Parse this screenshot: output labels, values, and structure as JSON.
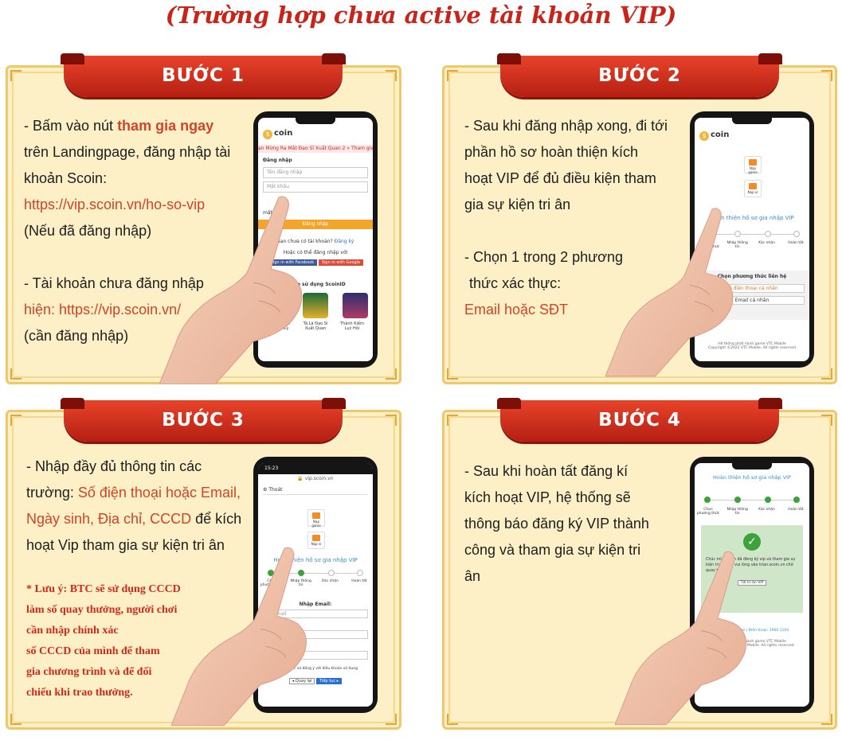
{
  "title": "(Trường hợp chưa active tài khoản VIP)",
  "steps": [
    {
      "label": "BƯỚC 1",
      "lines": {
        "l1a": "- Bấm vào nút ",
        "l1b": "tham gia ngay",
        "l2": "trên Landingpage, đăng nhập tài",
        "l3": "khoản Scoin:",
        "l4": "https://vip.scoin.vn/ho-so-vip",
        "l5": "(Nếu đã đăng nhập)",
        "l6": "- Tài khoản chưa đăng nhập",
        "l7a": "hiện: ",
        "l7b": "https://vip.scoin.vn/",
        "l8": "(cần đăng nhập)"
      },
      "phone": {
        "logo": "coin",
        "marquee": "ạn Mừng Ra Mắt Đạo Sĩ Xuất Quan 2 » Tham gia n",
        "login_title": "Đăng nhập",
        "username_placeholder": "Tên đăng nhập",
        "password_placeholder": "Mật khẩu",
        "forgot": "mật khẩu?",
        "login_btn": "Đăng nhập",
        "no_account": "Bạn chưa có tài khoản?",
        "register": "Đăng ký",
        "or_login": "Hoặc có thể đăng nhập với",
        "fb_btn": "Sign in with Facebook",
        "gg_btn": "Sign in with Google",
        "products_title": "Các sản phẩm sử dụng ScoinID",
        "games": [
          "Long Chiến Truyền Kỳ",
          "Tà Lã Đạo Sĩ Xuất Quan",
          "Thành Kiếm Lục Hỏi"
        ]
      }
    },
    {
      "label": "BƯỚC 2",
      "lines": {
        "l1": "- Sau khi đăng nhập xong, đi tới",
        "l2": "phần hồ sơ hoàn thiện kích",
        "l3": "hoạt VIP để đủ điều kiện tham",
        "l4": "gia sự kiện tri ân",
        "l5": "- Chọn 1 trong 2 phương",
        "l6": "thức xác thực:",
        "l7": "Email hoặc SĐT"
      },
      "phone": {
        "logo": "coin",
        "icon1": "Nạp game",
        "icon2": "Nạp ví",
        "heading": "Hoàn thiện hồ sơ gia nhập VIP",
        "step_labels": [
          "Chọn phương thức",
          "Nhập thông tin",
          "Xác nhận",
          "Hoàn tất"
        ],
        "method_title": "Chọn phương thức liên hệ",
        "opt1": "Số điện thoại cá nhân",
        "opt2": "Email cá nhân",
        "footer1": "Hệ thống phát hành game VTC Mobile",
        "footer2": "Copyright ©2022 VTC Mobile. All rights reserved"
      }
    },
    {
      "label": "BƯỚC 3",
      "lines": {
        "l1": "- Nhập đầy đủ thông tin các",
        "l2a": "trường: ",
        "l2b": "Số điện thoại hoặc Email,",
        "l3a": "Ngày sinh, Địa chỉ, CCCD",
        "l3b": " để kích",
        "l4": "hoạt Vip tham gia sự kiện tri ân"
      },
      "note": {
        "n1": "* Lưu ý: BTC sẽ sử dụng CCCD",
        "n2": "làm số quay thưởng, người chơi",
        "n3": "cần nhập  chính xác",
        "n4": "số CCCD của mình để tham",
        "n5": "gia chương trình và để đối",
        "n6": "chiếu khi trao thưởng."
      },
      "phone": {
        "time": "15:23",
        "url": "vip.scoin.vn",
        "back": "Thoát",
        "icon1": "Nạp game",
        "icon2": "Nạp ví",
        "heading": "Hoàn thiện hồ sơ gia nhập VIP",
        "step_labels": [
          "Chọn phương thức",
          "Nhập thông tin",
          "Xác nhận",
          "Hoàn tất"
        ],
        "email_label": "Nhập Email:",
        "email_ph": "email",
        "dob_label": "* Ngày sinh:",
        "dob_ph": "dd/mm/yyyy",
        "addr_label": "* Địa chỉ:",
        "addr_ph": "Nhập địa chỉ",
        "agree": "Tôi đã đọc và đồng ý với điều khoản sử dụng",
        "back_btn": "Quay lại",
        "next_btn": "Tiếp tục"
      }
    },
    {
      "label": "BƯỚC 4",
      "lines": {
        "l1": "- Sau khi hoàn tất đăng kí",
        "l2": "kích hoạt VIP, hệ thống sẽ",
        "l3": "thông báo đăng ký VIP thành",
        "l4": "công và tham gia sự kiện tri",
        "l5": "ân"
      },
      "phone": {
        "heading": "Hoàn thiện hồ sơ gia nhập VIP",
        "step_labels": [
          "Chọn phương thức",
          "Nhập thông tin",
          "Xác nhận",
          "Hoàn tất"
        ],
        "success": "Chúc mừng bạn đã đăng ký vip và tham gia sự kiện tri ân vip, vui lòng vào trian.scoin.vn chờ quay thưởng.",
        "ok_btn": "Tới tri ân VIP",
        "links": "Hỗ trợ | Fanpage | Điện thoại: 1900 1104",
        "footer1": "Hệ thống phát hành game VTC Mobile",
        "footer2": "Copyright 2022 VTC Mobile. All rights reserved"
      }
    }
  ],
  "colors": {
    "accent": "#d34328",
    "title": "#c8241a",
    "panel": "#fdf0c6",
    "ribbon": "#c8281a"
  }
}
